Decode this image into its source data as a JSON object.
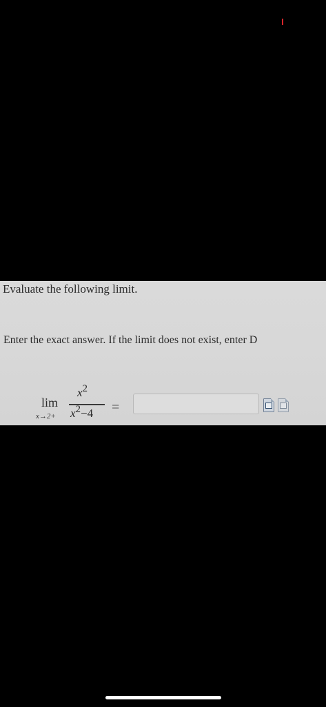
{
  "question": {
    "title": "Evaluate the following limit.",
    "instruction": "Enter the exact answer. If the limit does not exist, enter D"
  },
  "expression": {
    "lim": "lim",
    "subscript": "x→2+",
    "numerator_var": "x",
    "numerator_exp": "2",
    "denominator_var": "x",
    "denominator_exp": "2",
    "denominator_rest": "−4",
    "equals": "="
  },
  "answer": {
    "value": ""
  },
  "icons": [
    "calculator-icon",
    "document-icon"
  ],
  "colors": {
    "background": "#000000",
    "panel": "#d9d9d9",
    "status_mark": "#d9262b"
  }
}
